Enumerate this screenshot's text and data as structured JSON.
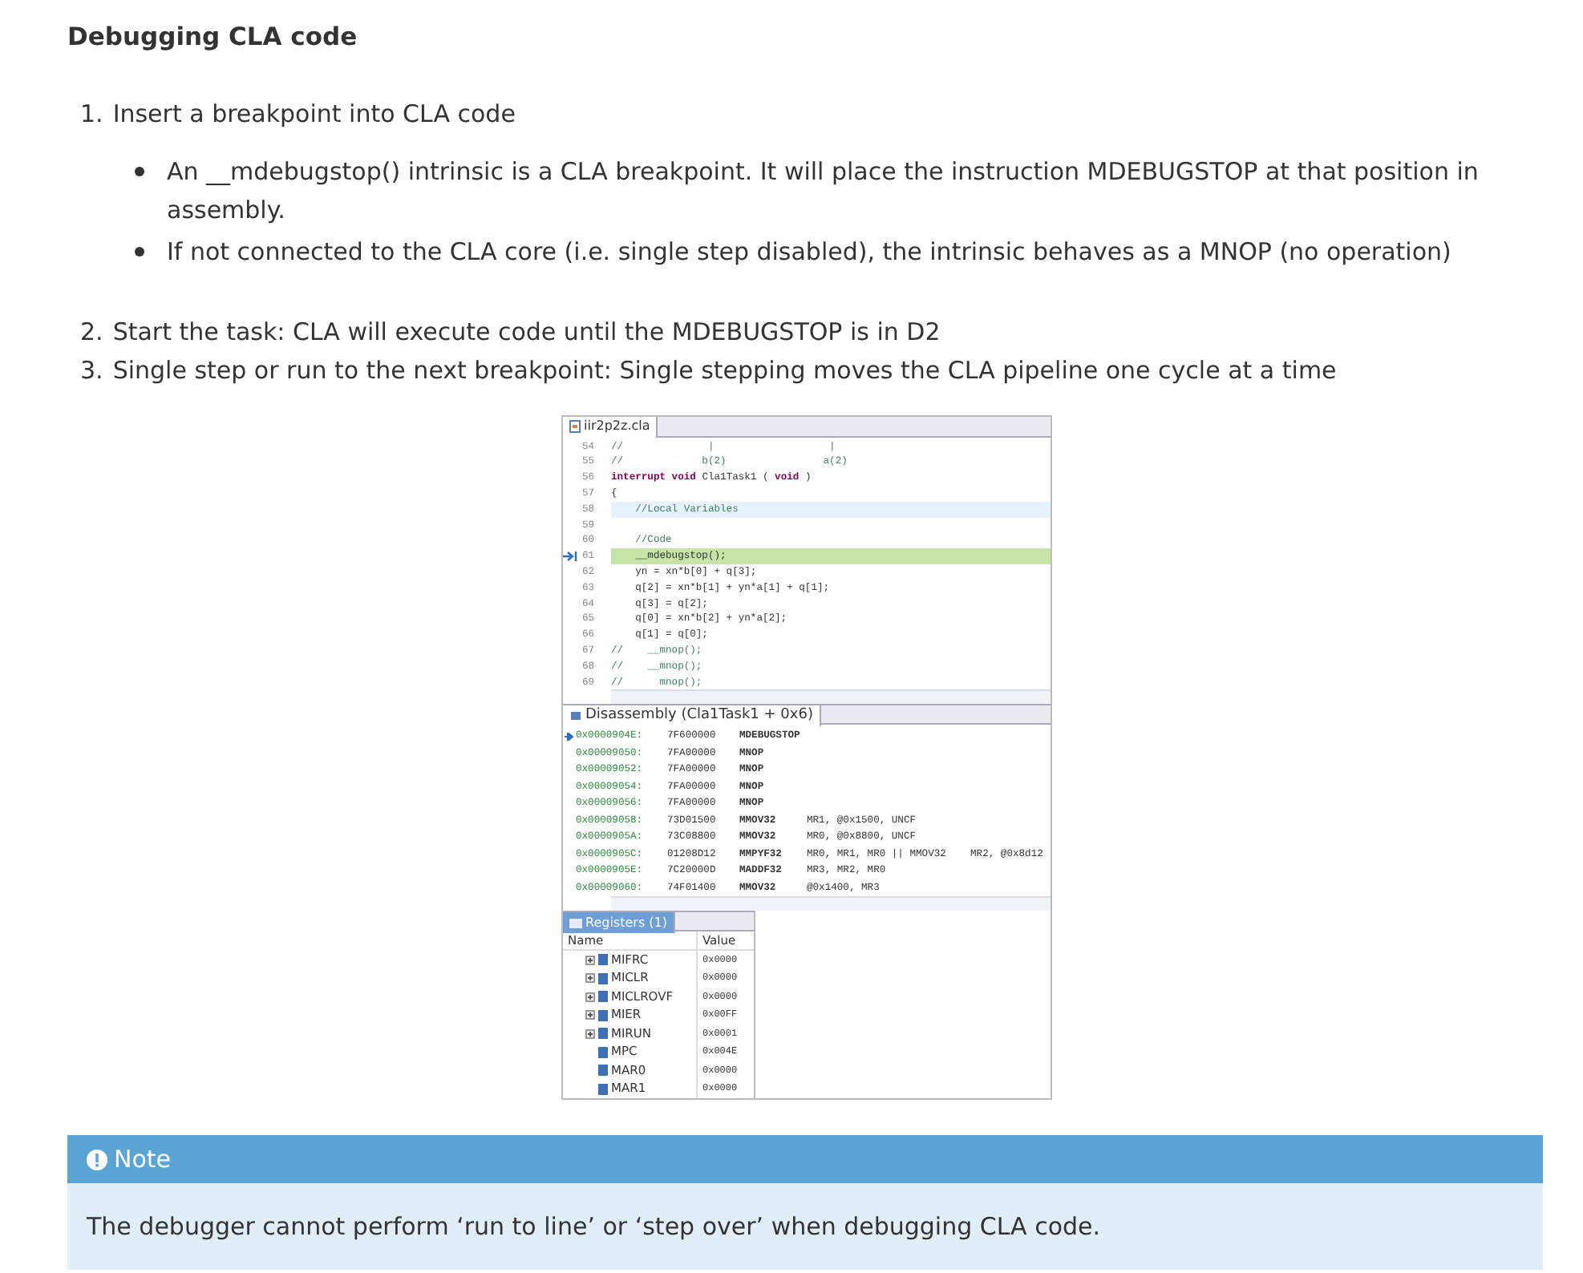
{
  "title": "Debugging CLA code",
  "steps": [
    {
      "number": "1.",
      "text": "Insert a breakpoint into CLA code",
      "bullets": [
        "An __mdebugstop() intrinsic is a CLA breakpoint. It will place the instruction MDEBUGSTOP at that position in assembly.",
        "If not connected to the CLA core (i.e. single step disabled), the intrinsic behaves as a MNOP (no operation)"
      ]
    },
    {
      "number": "2.",
      "text": "Start the task: CLA will execute code until the MDEBUGSTOP is in D2"
    },
    {
      "number": "3.",
      "text": "Single step or run to the next breakpoint: Single stepping moves the CLA pipeline one cycle at a time"
    }
  ],
  "screenshot": {
    "editor": {
      "tab": "iir2p2z.cla",
      "lines": [
        {
          "number": "54",
          "text": "//              |                   |",
          "comment": true
        },
        {
          "number": "55",
          "text": "//             b(2)                a(2)",
          "comment": true
        },
        {
          "number": "56",
          "text": "**interrupt** **void** Cla1Task1 ( **void** )",
          "comment": false
        },
        {
          "number": "57",
          "text": "{",
          "comment": false
        },
        {
          "number": "58",
          "text": "    //Local Variables",
          "comment": true,
          "current": true
        },
        {
          "number": "59"
        },
        {
          "number": "60",
          "text": "    //Code",
          "comment": true
        },
        {
          "number": "61",
          "text": "    __mdebugstop();",
          "comment": false,
          "stopped": true
        },
        {
          "number": "62",
          "text": "    yn = xn*b[0] + q[3];",
          "comment": false
        },
        {
          "number": "63",
          "text": "    q[2] = xn*b[1] + yn*a[1] + q[1];",
          "comment": false
        },
        {
          "number": "64",
          "text": "    q[3] = q[2];",
          "comment": false
        },
        {
          "number": "65",
          "text": "    q[0] = xn*b[2] + yn*a[2];",
          "comment": false
        },
        {
          "number": "66",
          "text": "    q[1] = q[0];",
          "comment": false
        },
        {
          "number": "67",
          "text": "//    __mnop();",
          "comment": true
        },
        {
          "number": "68",
          "text": "//    __mnop();",
          "comment": true
        },
        {
          "number": "69",
          "text": "//      mnop();",
          "comment": true
        }
      ]
    },
    "disassembly": {
      "tab": "Disassembly (Cla1Task1 + 0x6)",
      "rows": [
        {
          "address": "0x0000904E:",
          "opcode": "7F600000",
          "mnemonic": "MDEBUGSTOP",
          "current": true
        },
        {
          "address": "0x00009050:",
          "opcode": "7FA00000",
          "mnemonic": "MNOP",
          "current": false
        },
        {
          "address": "0x00009052:",
          "opcode": "7FA00000",
          "mnemonic": "MNOP",
          "current": false
        },
        {
          "address": "0x00009054:",
          "opcode": "7FA00000",
          "mnemonic": "MNOP",
          "current": false
        },
        {
          "address": "0x00009056:",
          "opcode": "7FA00000",
          "mnemonic": "MNOP",
          "current": false
        },
        {
          "address": "0x00009058:",
          "opcode": "73D01500",
          "mnemonic": "MMOV32",
          "operands": "MR1, @0x1500, UNCF",
          "current": false
        },
        {
          "address": "0x0000905A:",
          "opcode": "73C08800",
          "mnemonic": "MMOV32",
          "operands": "MR0, @0x8800, UNCF",
          "current": false
        },
        {
          "address": "0x0000905C:",
          "opcode": "01208D12",
          "mnemonic": "MMPYF32",
          "operands": "MR0, MR1, MR0 || MMOV32    MR2, @0x8d12",
          "current": false
        },
        {
          "address": "0x0000905E:",
          "opcode": "7C20000D",
          "mnemonic": "MADDF32",
          "operands": "MR3, MR2, MR0",
          "current": false
        },
        {
          "address": "0x00009060:",
          "opcode": "74F01400",
          "mnemonic": "MMOV32",
          "operands": "@0x1400, MR3",
          "current": false
        }
      ]
    },
    "registers": {
      "tab": "Registers (1)",
      "columns": [
        "Name",
        "Value"
      ],
      "rows": [
        {
          "name": "MIFRC",
          "value": "0x0000",
          "expandable": true
        },
        {
          "name": "MICLR",
          "value": "0x0000",
          "expandable": true
        },
        {
          "name": "MICLROVF",
          "value": "0x0000",
          "expandable": true
        },
        {
          "name": "MIER",
          "value": "0x00FF",
          "expandable": true
        },
        {
          "name": "MIRUN",
          "value": "0x0001",
          "expandable": true
        },
        {
          "name": "MPC",
          "value": "0x004E",
          "expandable": false
        },
        {
          "name": "MAR0",
          "value": "0x0000",
          "expandable": false
        },
        {
          "name": "MAR1",
          "value": "0x0000",
          "expandable": false
        }
      ]
    }
  },
  "note": {
    "heading": "Note",
    "text": "The debugger cannot perform ‘run to line’ or ‘step over’ when debugging CLA code."
  }
}
